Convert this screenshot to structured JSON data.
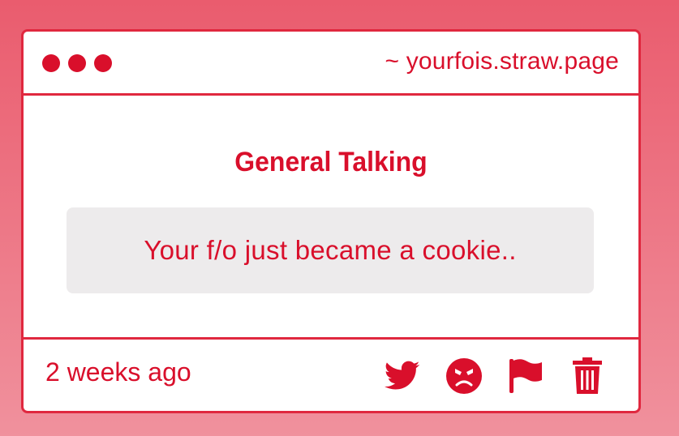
{
  "window": {
    "url": "~ yourfois.straw.page",
    "controls": [
      "dot",
      "dot",
      "dot"
    ]
  },
  "post": {
    "title": "General Talking",
    "message": "Your f/o just became a cookie..",
    "timestamp": "2 weeks ago"
  },
  "actions": [
    {
      "icon": "twitter-icon"
    },
    {
      "icon": "angry-face-icon"
    },
    {
      "icon": "flag-icon"
    },
    {
      "icon": "trash-icon"
    }
  ],
  "colors": {
    "accent": "#d90f2b",
    "border": "#e0283f",
    "message_bg": "#edebec",
    "background_top": "#ea5c6e",
    "background_bottom": "#f0919d"
  }
}
